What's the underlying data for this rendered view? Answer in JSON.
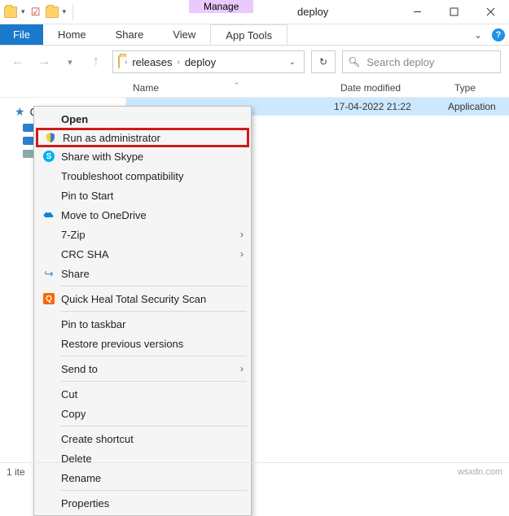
{
  "title": "deploy",
  "ribbon": {
    "context_tab": "Manage",
    "context_tool": "App Tools",
    "file": "File",
    "tabs": [
      "Home",
      "Share",
      "View"
    ]
  },
  "breadcrumb": {
    "segments": [
      "releases",
      "deploy"
    ]
  },
  "search": {
    "placeholder": "Search deploy"
  },
  "columns": {
    "name": "Name",
    "date": "Date modified",
    "type": "Type"
  },
  "nav": {
    "quick_access": "Quick access"
  },
  "rows": [
    {
      "name": "",
      "date": "17-04-2022 21:22",
      "type": "Application"
    }
  ],
  "status": {
    "text": "1 ite"
  },
  "ctx": {
    "open": "Open",
    "run_admin": "Run as administrator",
    "skype": "Share with Skype",
    "troubleshoot": "Troubleshoot compatibility",
    "pin_start": "Pin to Start",
    "onedrive": "Move to OneDrive",
    "sevenzip": "7-Zip",
    "crc": "CRC SHA",
    "share": "Share",
    "quickheal": "Quick Heal Total Security Scan",
    "pin_taskbar": "Pin to taskbar",
    "restore": "Restore previous versions",
    "send_to": "Send to",
    "cut": "Cut",
    "copy": "Copy",
    "shortcut": "Create shortcut",
    "delete": "Delete",
    "rename": "Rename",
    "properties": "Properties"
  },
  "watermark": "wsxdn.com"
}
